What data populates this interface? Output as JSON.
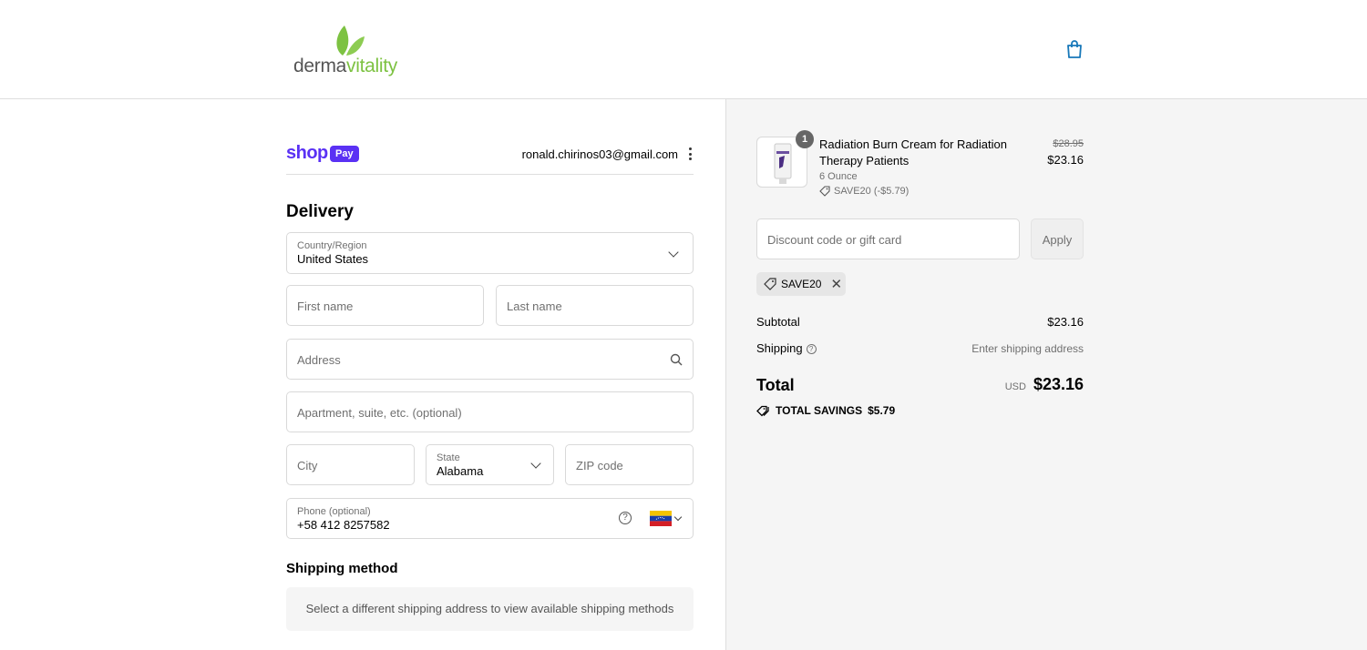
{
  "brand": {
    "name_part1": "derma",
    "name_part2": "vitality"
  },
  "account": {
    "shop_label": "shop",
    "pay_label": "Pay",
    "email": "ronald.chirinos03@gmail.com"
  },
  "delivery": {
    "heading": "Delivery",
    "country": {
      "label": "Country/Region",
      "value": "United States"
    },
    "first_name": {
      "placeholder": "First name"
    },
    "last_name": {
      "placeholder": "Last name"
    },
    "address": {
      "placeholder": "Address"
    },
    "apartment": {
      "placeholder": "Apartment, suite, etc. (optional)"
    },
    "city": {
      "placeholder": "City"
    },
    "state": {
      "label": "State",
      "value": "Alabama"
    },
    "zip": {
      "placeholder": "ZIP code"
    },
    "phone": {
      "label": "Phone (optional)",
      "value": "+58 412 8257582"
    }
  },
  "shipping_method": {
    "heading": "Shipping method",
    "message": "Select a different shipping address to view available shipping methods"
  },
  "order": {
    "item": {
      "quantity": "1",
      "name": "Radiation Burn Cream for Radiation Therapy Patients",
      "variant": "6 Ounce",
      "discount": "SAVE20 (-$5.79)",
      "original_price": "$28.95",
      "price": "$23.16"
    },
    "discount_placeholder": "Discount code or gift card",
    "apply_label": "Apply",
    "applied_code": "SAVE20",
    "subtotal_label": "Subtotal",
    "subtotal_value": "$23.16",
    "shipping_label": "Shipping",
    "shipping_value": "Enter shipping address",
    "total_label": "Total",
    "currency": "USD",
    "total_value": "$23.16",
    "savings_label": "TOTAL SAVINGS",
    "savings_value": "$5.79"
  },
  "colors": {
    "brand_green": "#7dc242",
    "shop_purple": "#5a31f4",
    "accent_blue": "#1878b9"
  }
}
